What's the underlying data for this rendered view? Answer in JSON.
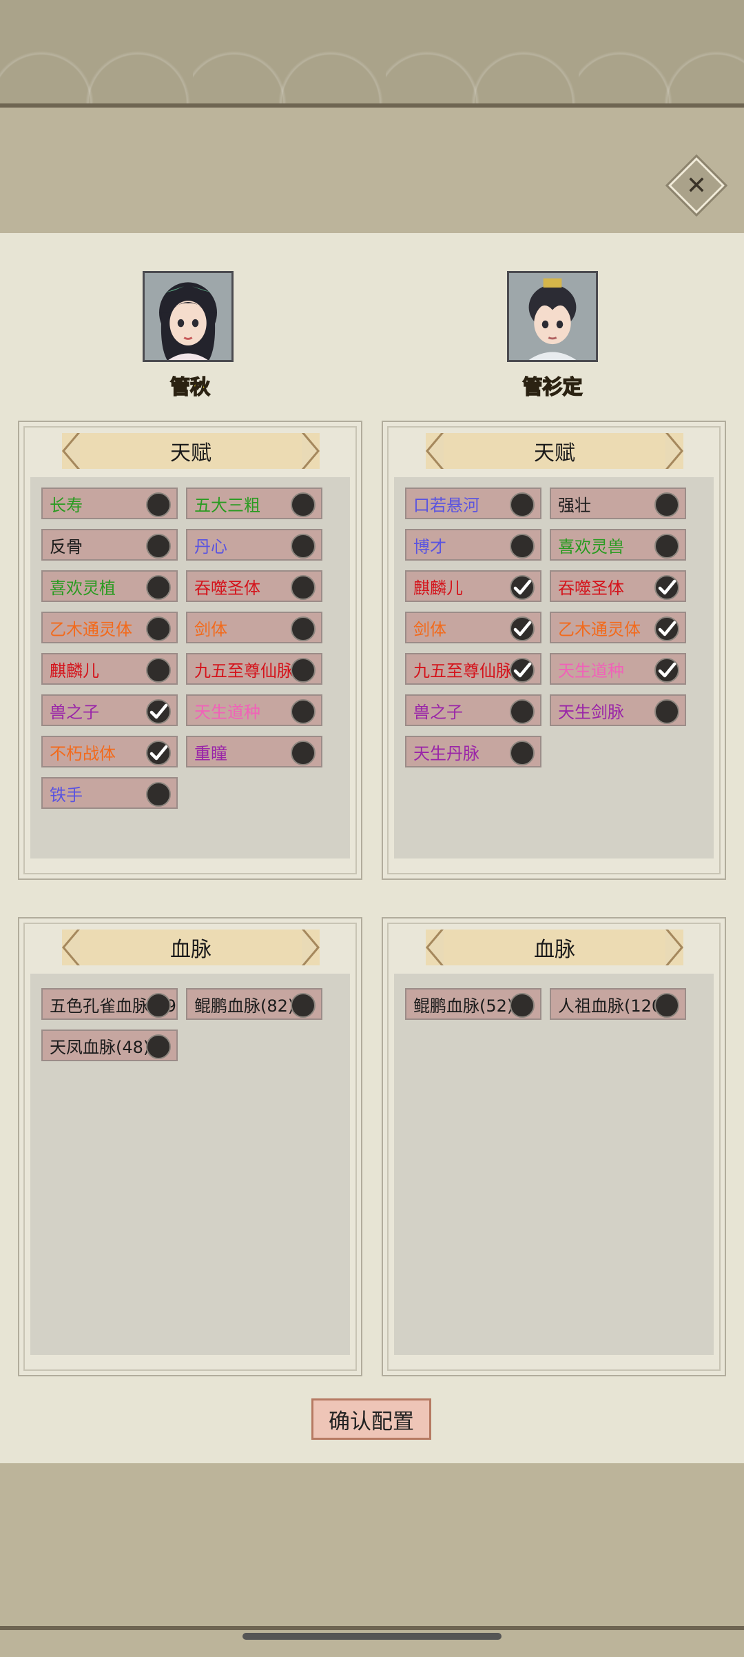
{
  "close_label": "✕",
  "characters": [
    {
      "name": "管秋"
    },
    {
      "name": "管衫定"
    }
  ],
  "sections": {
    "talent_title": "天赋",
    "bloodline_title": "血脉"
  },
  "left_talents": [
    {
      "label": "长寿",
      "color": "#2a9b21",
      "checked": false
    },
    {
      "label": "五大三粗",
      "color": "#2a9b21",
      "checked": false
    },
    {
      "label": "反骨",
      "color": "#1b1b1b",
      "checked": false
    },
    {
      "label": "丹心",
      "color": "#5a54e0",
      "checked": false
    },
    {
      "label": "喜欢灵植",
      "color": "#2a9b21",
      "checked": false
    },
    {
      "label": "吞噬圣体",
      "color": "#d4141c",
      "checked": false
    },
    {
      "label": "乙木通灵体",
      "color": "#f26a1c",
      "checked": false
    },
    {
      "label": "剑体",
      "color": "#f26a1c",
      "checked": false
    },
    {
      "label": "麒麟儿",
      "color": "#d4141c",
      "checked": false
    },
    {
      "label": "九五至尊仙脉",
      "color": "#d4141c",
      "checked": false
    },
    {
      "label": "兽之子",
      "color": "#9a25a8",
      "checked": true
    },
    {
      "label": "天生道种",
      "color": "#f062b8",
      "checked": false
    },
    {
      "label": "不朽战体",
      "color": "#f26a1c",
      "checked": true
    },
    {
      "label": "重瞳",
      "color": "#9a25a8",
      "checked": false
    },
    {
      "label": "铁手",
      "color": "#5a54e0",
      "checked": false
    }
  ],
  "right_talents": [
    {
      "label": "口若悬河",
      "color": "#5a54e0",
      "checked": false
    },
    {
      "label": "强壮",
      "color": "#1b1b1b",
      "checked": false
    },
    {
      "label": "博才",
      "color": "#5a54e0",
      "checked": false
    },
    {
      "label": "喜欢灵兽",
      "color": "#2a9b21",
      "checked": false
    },
    {
      "label": "麒麟儿",
      "color": "#d4141c",
      "checked": true
    },
    {
      "label": "吞噬圣体",
      "color": "#d4141c",
      "checked": true
    },
    {
      "label": "剑体",
      "color": "#f26a1c",
      "checked": true
    },
    {
      "label": "乙木通灵体",
      "color": "#f26a1c",
      "checked": true
    },
    {
      "label": "九五至尊仙脉",
      "color": "#d4141c",
      "checked": true
    },
    {
      "label": "天生道种",
      "color": "#f062b8",
      "checked": true
    },
    {
      "label": "兽之子",
      "color": "#9a25a8",
      "checked": false
    },
    {
      "label": "天生剑脉",
      "color": "#9a25a8",
      "checked": false
    },
    {
      "label": "天生丹脉",
      "color": "#9a25a8",
      "checked": false
    }
  ],
  "left_bloodlines": [
    {
      "label": "五色孔雀血脉(59",
      "color": "#1b1b1b",
      "checked": false
    },
    {
      "label": "鲲鹏血脉(82)",
      "color": "#1b1b1b",
      "checked": false
    },
    {
      "label": "天凤血脉(48)",
      "color": "#1b1b1b",
      "checked": false
    }
  ],
  "right_bloodlines": [
    {
      "label": "鲲鹏血脉(52)",
      "color": "#1b1b1b",
      "checked": false
    },
    {
      "label": "人祖血脉(120)",
      "color": "#1b1b1b",
      "checked": false
    }
  ],
  "confirm_label": "确认配置"
}
